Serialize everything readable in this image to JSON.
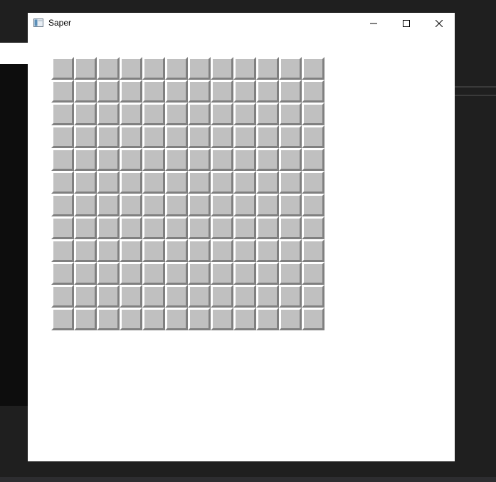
{
  "window": {
    "title": "Saper",
    "icon": "app-window-icon"
  },
  "controls": {
    "minimize": "minimize-icon",
    "maximize": "maximize-icon",
    "close": "close-icon"
  },
  "board": {
    "rows": 12,
    "columns": 12,
    "cell_state": "unrevealed"
  },
  "colors": {
    "cell_face": "#c0c0c0",
    "cell_highlight": "#ffffff",
    "cell_shadow": "#808080"
  }
}
